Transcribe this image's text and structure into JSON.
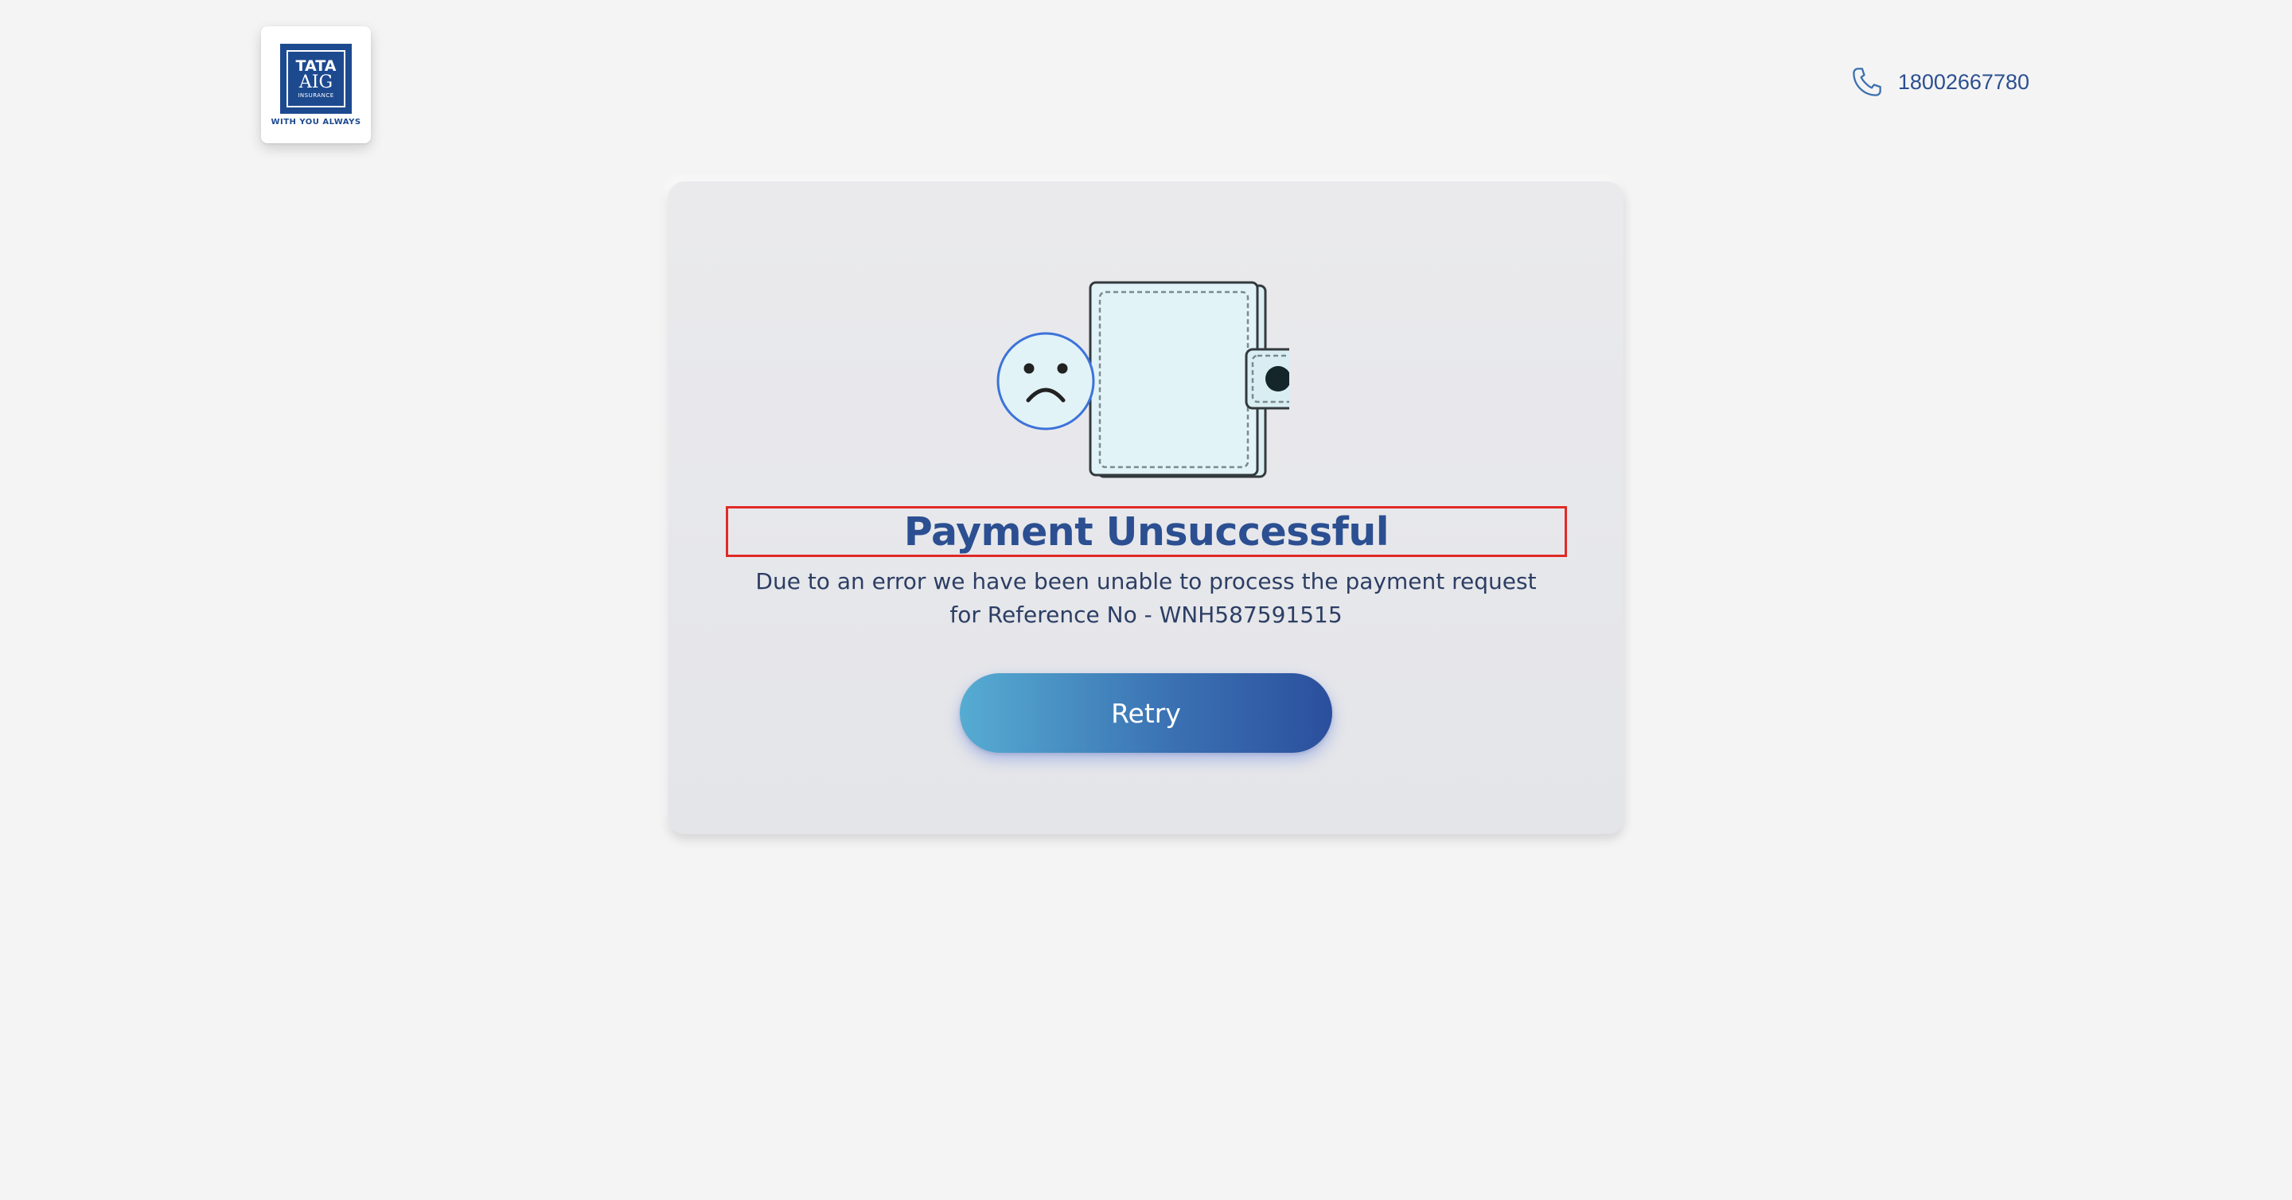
{
  "brand": {
    "logo_line1": "TATA",
    "logo_line2": "AIG",
    "logo_line3": "INSURANCE",
    "tagline": "WITH YOU ALWAYS",
    "color": "#1d4a8f"
  },
  "header": {
    "phone_icon": "phone-icon",
    "phone_number": "18002667780"
  },
  "card": {
    "illustration": "sad-wallet-icon",
    "title": "Payment Unsuccessful",
    "message_line1": "Due to an error we have been unable to process the payment request",
    "message_line2": "for Reference No - WNH587591515",
    "retry_label": "Retry"
  },
  "colors": {
    "primary": "#2b4f91",
    "highlight_border": "#e02a26",
    "button_gradient_start": "#56acd2",
    "button_gradient_end": "#2b4f9d",
    "background": "#f4f4f4"
  }
}
